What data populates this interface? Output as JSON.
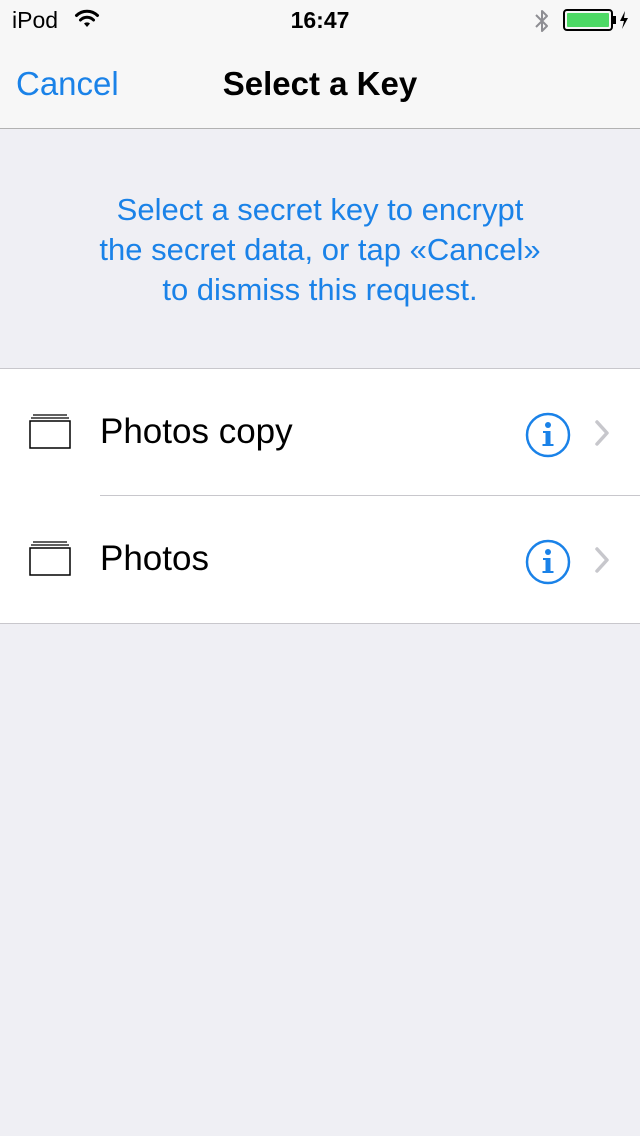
{
  "status_bar": {
    "carrier": "iPod",
    "time": "16:47",
    "battery_color": "#4cd964"
  },
  "nav": {
    "cancel_label": "Cancel",
    "title": "Select a Key"
  },
  "instruction": {
    "lines": [
      "Select a secret key to encrypt",
      "the secret data, or tap «Cancel»",
      "to dismiss this request."
    ]
  },
  "keys": [
    {
      "name": "Photos copy",
      "icon": "folder-icon"
    },
    {
      "name": "Photos",
      "icon": "folder-icon"
    }
  ],
  "colors": {
    "accent": "#1a82e8",
    "background": "#efeff4"
  }
}
